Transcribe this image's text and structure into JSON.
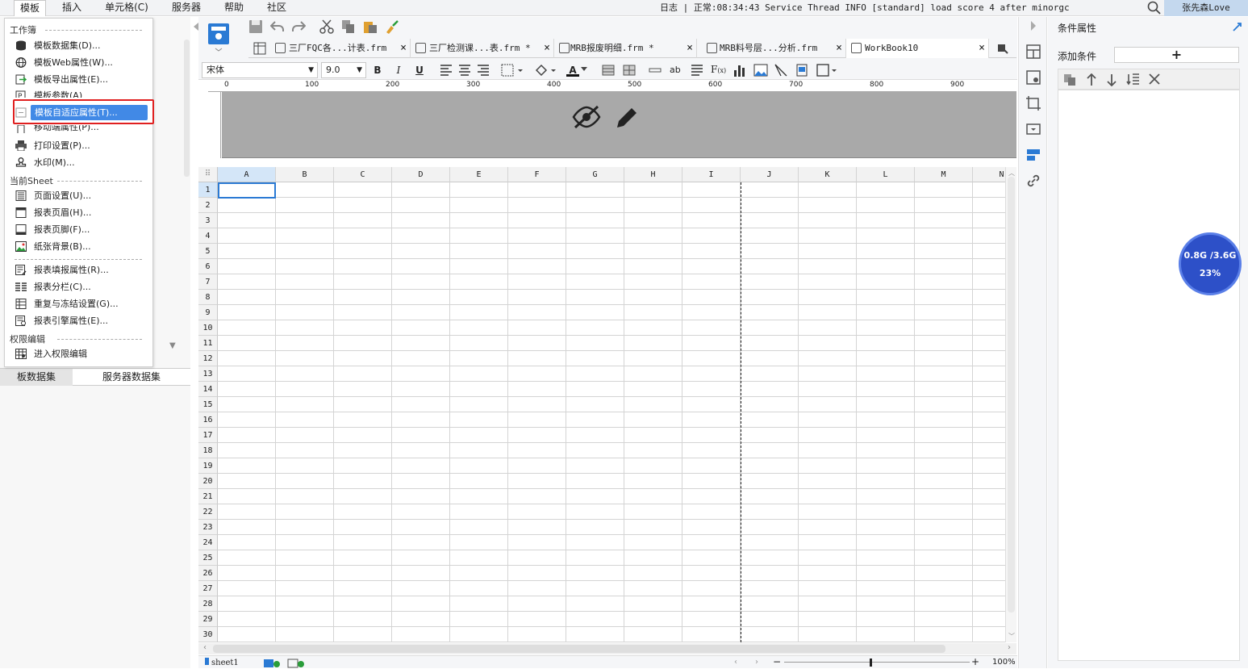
{
  "menubar": {
    "items": [
      "模板",
      "插入",
      "单元格(C)",
      "服务器",
      "帮助",
      "社区"
    ],
    "status": "日志 | 正常:08:34:43 Service Thread INFO [standard] load score 4 after minorgc",
    "user": "张先森Love"
  },
  "dropdown": {
    "section_workbook": "工作簿",
    "items_workbook": [
      "模板数据集(D)...",
      "模板Web属性(W)...",
      "模板导出属性(E)...",
      "模板参数(A)",
      "模板自适应属性(T)...",
      "移动端属性(P)...",
      "打印设置(P)...",
      "水印(M)..."
    ],
    "section_sheet": "当前Sheet",
    "items_sheet": [
      "页面设置(U)...",
      "报表页眉(H)...",
      "报表页脚(F)...",
      "纸张背景(B)..."
    ],
    "items_sheet2": [
      "报表填报属性(R)...",
      "报表分栏(C)...",
      "重复与冻结设置(G)...",
      "报表引擎属性(E)..."
    ],
    "section_perm": "权限编辑",
    "items_perm": [
      "进入权限编辑"
    ]
  },
  "leftpanel": {
    "tabs": [
      "板数据集",
      "服务器数据集"
    ]
  },
  "tabs": [
    {
      "label": "三厂FQC各...计表.frm",
      "close": "×"
    },
    {
      "label": "三厂检测课...表.frm *",
      "close": "×"
    },
    {
      "label": "MRB报废明细.frm *",
      "close": "×"
    },
    {
      "label": "MRB料号层...分析.frm",
      "close": "×"
    },
    {
      "label": "WorkBook10",
      "close": "×"
    }
  ],
  "format": {
    "font": "宋体",
    "size": "9.0",
    "bold": "B",
    "italic": "I",
    "underline": "U",
    "textcolor": "A"
  },
  "ruler": {
    "marks": [
      "0",
      "100",
      "200",
      "300",
      "400",
      "500",
      "600",
      "700",
      "800",
      "900"
    ]
  },
  "grid": {
    "columns": [
      "A",
      "B",
      "C",
      "D",
      "E",
      "F",
      "G",
      "H",
      "I",
      "J",
      "K",
      "L",
      "M",
      "N"
    ],
    "rows": [
      "1",
      "2",
      "3",
      "4",
      "5",
      "6",
      "7",
      "8",
      "9",
      "10",
      "11",
      "12",
      "13",
      "14",
      "15",
      "16",
      "17",
      "18",
      "19",
      "20",
      "21",
      "22",
      "23",
      "24",
      "25",
      "26",
      "27",
      "28",
      "29",
      "30"
    ]
  },
  "bottom": {
    "sheet": "sheet1",
    "zoom": "100%",
    "minus": "−",
    "plus": "+"
  },
  "rightpanel": {
    "title": "条件属性",
    "add_label": "添加条件",
    "add_btn": "+"
  },
  "memory": {
    "usage": "0.8G /3.6G",
    "percent": "23%"
  },
  "colors": {
    "highlight": "#4189e6",
    "redbox": "#e02020",
    "memory": "#2d50c8"
  }
}
